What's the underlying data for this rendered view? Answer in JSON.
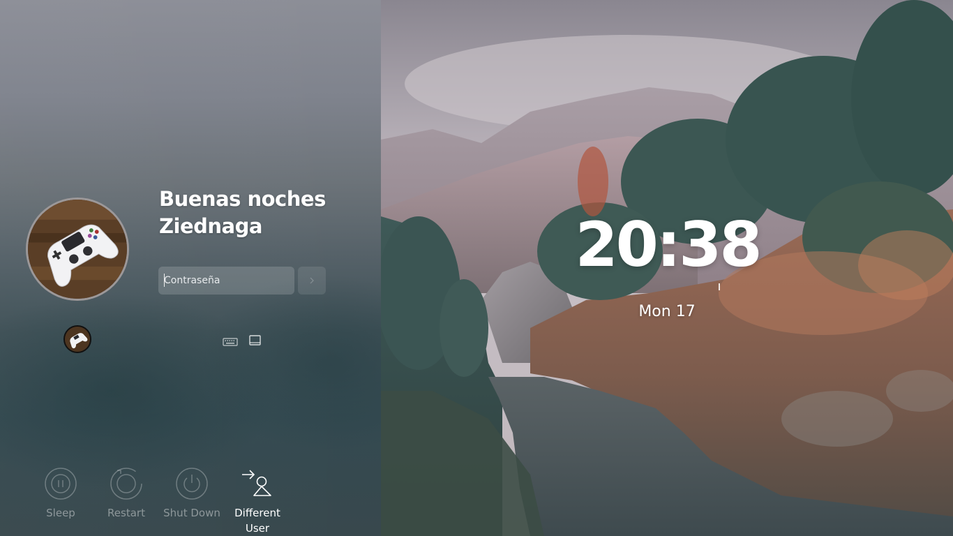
{
  "greeting": {
    "line1": "Buenas noches",
    "line2": "Ziednaga"
  },
  "login": {
    "password_placeholder": "Contraseña"
  },
  "power_actions": [
    {
      "label": "Sleep",
      "icon": "sleep-icon"
    },
    {
      "label": "Restart",
      "icon": "restart-icon"
    },
    {
      "label": "Shut Down",
      "icon": "power-icon"
    },
    {
      "label": "Different User",
      "icon": "switch-user-icon"
    }
  ],
  "clock": {
    "time": "20:38",
    "date": "Mon 17"
  },
  "icons": {
    "avatar": "gamepad-avatar",
    "keyboard": "keyboard-icon",
    "screen": "virtual-keyboard-icon",
    "submit": "arrow-right-icon"
  },
  "colors": {
    "panel_top": "#8c8e97",
    "panel_bottom": "#38484d",
    "text": "#ffffff"
  }
}
